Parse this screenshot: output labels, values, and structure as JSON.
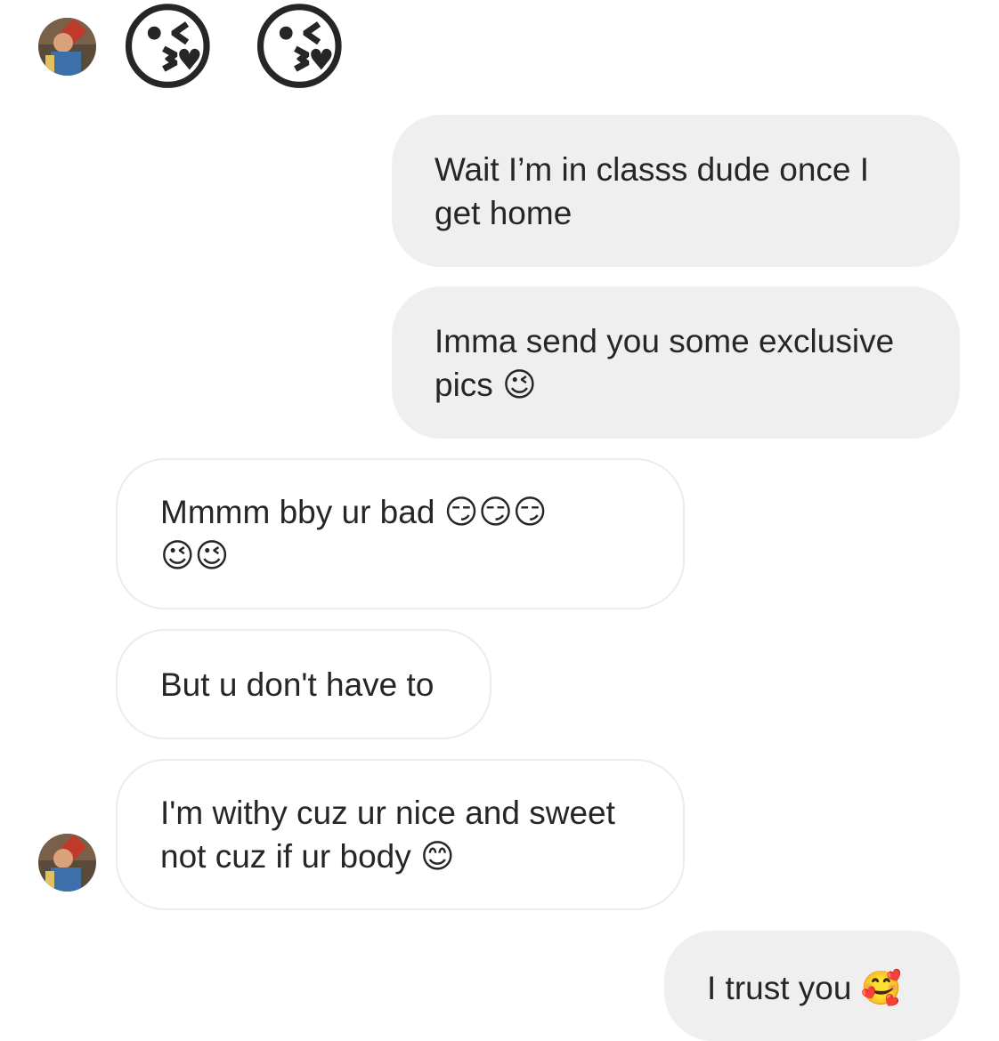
{
  "conversation": {
    "top_emoji": [
      "😘",
      "😘"
    ],
    "messages": [
      {
        "sender": "me",
        "text": "Wait I’m in classs dude once I\nget home"
      },
      {
        "sender": "me",
        "text": "Imma send you some exclusive\npics 😉"
      },
      {
        "sender": "them",
        "text": "Mmmm bby ur bad 😏😏😏\n😉😉"
      },
      {
        "sender": "them",
        "text": "But u don't have to"
      },
      {
        "sender": "them",
        "text": "I'm withy cuz ur nice and sweet\nnot cuz if ur body 😊"
      },
      {
        "sender": "me",
        "text": "I trust you 🥰"
      }
    ]
  },
  "colors": {
    "outgoing_bubble": "#efefef",
    "incoming_border": "#ececec",
    "text": "#262626"
  }
}
